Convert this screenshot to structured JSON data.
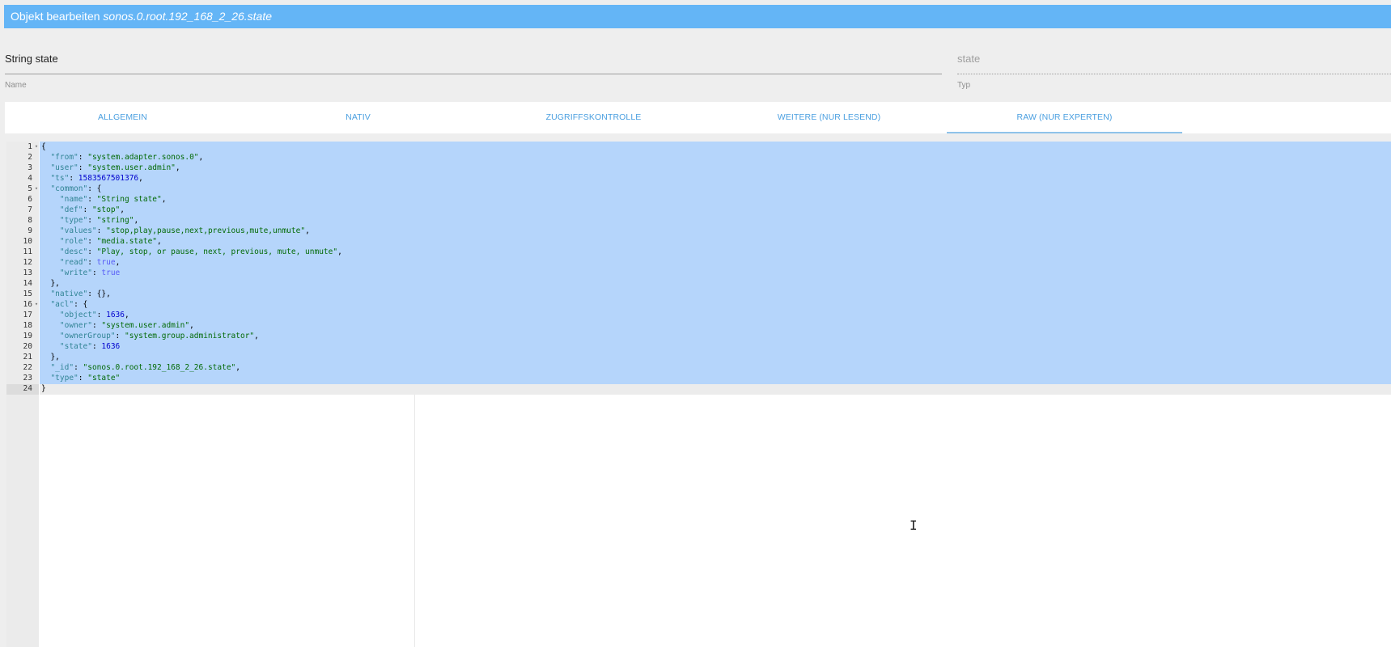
{
  "dialog": {
    "title_prefix": "Objekt bearbeiten ",
    "object_id": "sonos.0.root.192_168_2_26.state"
  },
  "fields": {
    "name": {
      "value": "String state",
      "label": "Name"
    },
    "type": {
      "value": "state",
      "label": "Typ"
    }
  },
  "tabs": [
    {
      "label": "ALLGEMEIN",
      "active": false
    },
    {
      "label": "NATIV",
      "active": false
    },
    {
      "label": "ZUGRIFFSKONTROLLE",
      "active": false
    },
    {
      "label": "WEITERE (NUR LESEND)",
      "active": false
    },
    {
      "label": "RAW (NUR EXPERTEN)",
      "active": true
    }
  ],
  "editor": {
    "active_line": 24,
    "selection": "lines 1-24",
    "lines": [
      {
        "num": "1",
        "fold": true,
        "indent": 0,
        "tokens": [
          [
            "p",
            "{"
          ]
        ]
      },
      {
        "num": "2",
        "fold": false,
        "indent": 2,
        "tokens": [
          [
            "k",
            "\"from\""
          ],
          [
            "p",
            ": "
          ],
          [
            "s2",
            "\"system.adapter.sonos.0\""
          ],
          [
            "p",
            ","
          ]
        ]
      },
      {
        "num": "3",
        "fold": false,
        "indent": 2,
        "tokens": [
          [
            "k",
            "\"user\""
          ],
          [
            "p",
            ": "
          ],
          [
            "s2",
            "\"system.user.admin\""
          ],
          [
            "p",
            ","
          ]
        ]
      },
      {
        "num": "4",
        "fold": false,
        "indent": 2,
        "tokens": [
          [
            "k",
            "\"ts\""
          ],
          [
            "p",
            ": "
          ],
          [
            "n",
            "1583567501376"
          ],
          [
            "p",
            ","
          ]
        ]
      },
      {
        "num": "5",
        "fold": true,
        "indent": 2,
        "tokens": [
          [
            "k",
            "\"common\""
          ],
          [
            "p",
            ": {"
          ]
        ]
      },
      {
        "num": "6",
        "fold": false,
        "indent": 4,
        "tokens": [
          [
            "k",
            "\"name\""
          ],
          [
            "p",
            ": "
          ],
          [
            "s2",
            "\"String state\""
          ],
          [
            "p",
            ","
          ]
        ]
      },
      {
        "num": "7",
        "fold": false,
        "indent": 4,
        "tokens": [
          [
            "k",
            "\"def\""
          ],
          [
            "p",
            ": "
          ],
          [
            "s2",
            "\"stop\""
          ],
          [
            "p",
            ","
          ]
        ]
      },
      {
        "num": "8",
        "fold": false,
        "indent": 4,
        "tokens": [
          [
            "k",
            "\"type\""
          ],
          [
            "p",
            ": "
          ],
          [
            "s2",
            "\"string\""
          ],
          [
            "p",
            ","
          ]
        ]
      },
      {
        "num": "9",
        "fold": false,
        "indent": 4,
        "tokens": [
          [
            "k",
            "\"values\""
          ],
          [
            "p",
            ": "
          ],
          [
            "s2",
            "\"stop,play,pause,next,previous,mute,unmute\""
          ],
          [
            "p",
            ","
          ]
        ]
      },
      {
        "num": "10",
        "fold": false,
        "indent": 4,
        "tokens": [
          [
            "k",
            "\"role\""
          ],
          [
            "p",
            ": "
          ],
          [
            "s2",
            "\"media.state\""
          ],
          [
            "p",
            ","
          ]
        ]
      },
      {
        "num": "11",
        "fold": false,
        "indent": 4,
        "tokens": [
          [
            "k",
            "\"desc\""
          ],
          [
            "p",
            ": "
          ],
          [
            "s2",
            "\"Play, stop, or pause, next, previous, mute, unmute\""
          ],
          [
            "p",
            ","
          ]
        ]
      },
      {
        "num": "12",
        "fold": false,
        "indent": 4,
        "tokens": [
          [
            "k",
            "\"read\""
          ],
          [
            "p",
            ": "
          ],
          [
            "b",
            "true"
          ],
          [
            "p",
            ","
          ]
        ]
      },
      {
        "num": "13",
        "fold": false,
        "indent": 4,
        "tokens": [
          [
            "k",
            "\"write\""
          ],
          [
            "p",
            ": "
          ],
          [
            "b",
            "true"
          ]
        ]
      },
      {
        "num": "14",
        "fold": false,
        "indent": 2,
        "tokens": [
          [
            "p",
            "},"
          ]
        ]
      },
      {
        "num": "15",
        "fold": false,
        "indent": 2,
        "tokens": [
          [
            "k",
            "\"native\""
          ],
          [
            "p",
            ": {},"
          ]
        ]
      },
      {
        "num": "16",
        "fold": true,
        "indent": 2,
        "tokens": [
          [
            "k",
            "\"acl\""
          ],
          [
            "p",
            ": {"
          ]
        ]
      },
      {
        "num": "17",
        "fold": false,
        "indent": 4,
        "tokens": [
          [
            "k",
            "\"object\""
          ],
          [
            "p",
            ": "
          ],
          [
            "n",
            "1636"
          ],
          [
            "p",
            ","
          ]
        ]
      },
      {
        "num": "18",
        "fold": false,
        "indent": 4,
        "tokens": [
          [
            "k",
            "\"owner\""
          ],
          [
            "p",
            ": "
          ],
          [
            "s2",
            "\"system.user.admin\""
          ],
          [
            "p",
            ","
          ]
        ]
      },
      {
        "num": "19",
        "fold": false,
        "indent": 4,
        "tokens": [
          [
            "k",
            "\"ownerGroup\""
          ],
          [
            "p",
            ": "
          ],
          [
            "s2",
            "\"system.group.administrator\""
          ],
          [
            "p",
            ","
          ]
        ]
      },
      {
        "num": "20",
        "fold": false,
        "indent": 4,
        "tokens": [
          [
            "k",
            "\"state\""
          ],
          [
            "p",
            ": "
          ],
          [
            "n",
            "1636"
          ]
        ]
      },
      {
        "num": "21",
        "fold": false,
        "indent": 2,
        "tokens": [
          [
            "p",
            "},"
          ]
        ]
      },
      {
        "num": "22",
        "fold": false,
        "indent": 2,
        "tokens": [
          [
            "k",
            "\"_id\""
          ],
          [
            "p",
            ": "
          ],
          [
            "s2",
            "\"sonos.0.root.192_168_2_26.state\""
          ],
          [
            "p",
            ","
          ]
        ]
      },
      {
        "num": "23",
        "fold": false,
        "indent": 2,
        "tokens": [
          [
            "k",
            "\"type\""
          ],
          [
            "p",
            ": "
          ],
          [
            "s2",
            "\"state\""
          ]
        ]
      },
      {
        "num": "24",
        "fold": false,
        "indent": 0,
        "tokens": [
          [
            "p",
            "}"
          ]
        ]
      }
    ]
  },
  "colors": {
    "titlebar": "#64b5f6",
    "tab_text": "#4a9fe0",
    "selection": "#b5d5fb",
    "json_key": "#318495",
    "json_string": "#036a07",
    "json_number": "#0000cd",
    "json_boolean": "#585cf6"
  },
  "icons": {
    "fold_marker": "fold-arrow-icon",
    "mouse_cursor": "text-cursor-icon"
  }
}
